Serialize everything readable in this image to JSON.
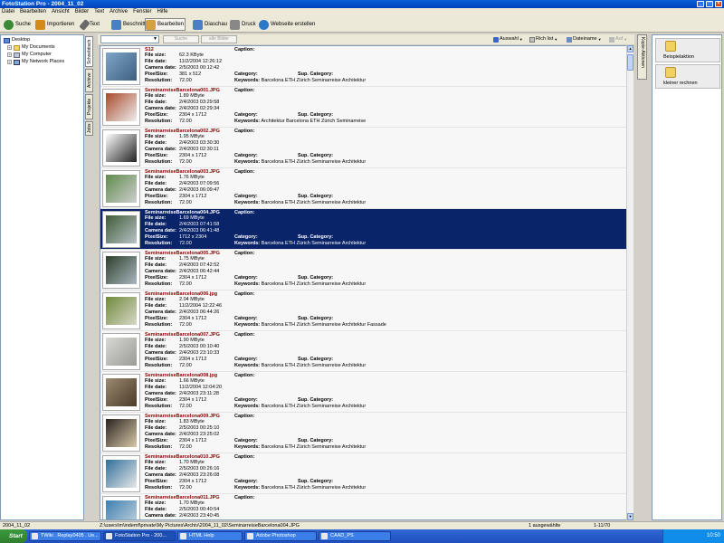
{
  "window": {
    "title": "FotoStation Pro - 2004_11_02"
  },
  "menu": [
    "Datei",
    "Bearbeiten",
    "Ansicht",
    "Bilder",
    "Text",
    "Archive",
    "Fenster",
    "Hilfe"
  ],
  "toolbar": [
    {
      "label": "Suche",
      "color": "#3a8a3a"
    },
    {
      "label": "Importieren",
      "color": "#d48a18"
    },
    {
      "label": "Text",
      "color": "#6a6a6a"
    },
    {
      "label": "Beschnitt",
      "color": "#4a7fc8"
    },
    {
      "label": "Bearbeiten",
      "color": "#d4a040"
    },
    {
      "label": "Diaschau",
      "color": "#4a7fc8"
    },
    {
      "label": "Druck",
      "color": "#888888"
    },
    {
      "label": "Webseite erstellen",
      "color": "#2a78c8"
    }
  ],
  "tree": [
    {
      "label": "Desktop",
      "level": 0,
      "pm": ""
    },
    {
      "label": "My Documents",
      "level": 1,
      "pm": "+"
    },
    {
      "label": "My Computer",
      "level": 1,
      "pm": "+"
    },
    {
      "label": "My Network Places",
      "level": 1,
      "pm": "+"
    }
  ],
  "vtabs": [
    "Schreibtisch",
    "Archive",
    "Projekte",
    "Jobs"
  ],
  "filter": {
    "search_btn": "Suche",
    "all_btn": "alle Bilder",
    "auswahl": "Auswahl",
    "richlist": "Rich list",
    "dateiname": "Dateiname",
    "aufab": "Auf"
  },
  "labels": {
    "file_size": "File size:",
    "file_date": "File date:",
    "camera_date": "Camera date:",
    "pixel_size": "PixelSize:",
    "resolution": "Resolution:",
    "caption": "Caption:",
    "category": "Category:",
    "sup_category": "Sup. Category:",
    "keywords": "Keywords:"
  },
  "files": [
    {
      "name": "S12",
      "size": "62.3 KByte",
      "date": "11/2/2004 12:26:12",
      "camera": "2/5/2003 00:12:42",
      "pixels": "381 x 512",
      "res": "72.00",
      "keywords": "Barcelona ETH Zürich Seminarreise Architektur",
      "selected": false,
      "tone": [
        "#7ea6c8",
        "#3d5f80"
      ]
    },
    {
      "name": "SeminarreiseBarcelona001.JPG",
      "size": "1.89 MByte",
      "date": "2/4/2003 03:29:58",
      "camera": "2/4/2003 02:29:34",
      "pixels": "2304 x 1712",
      "res": "72.00",
      "keywords": "Architektur Barcelona ETH Zürich Seminarreise",
      "selected": false,
      "tone": [
        "#a84a2a",
        "#eeeeee"
      ]
    },
    {
      "name": "SeminarreiseBarcelona002.JPG",
      "size": "1.95 MByte",
      "date": "2/4/2003 03:30:30",
      "camera": "2/4/2003 02:30:11",
      "pixels": "2304 x 1712",
      "res": "72.00",
      "keywords": "Barcelona ETH Zürich Seminarreise Architektur",
      "selected": false,
      "tone": [
        "#ffffff",
        "#222222"
      ]
    },
    {
      "name": "SeminarreiseBarcelona003.JPG",
      "size": "1.76 MByte",
      "date": "2/4/2003 07:09:56",
      "camera": "2/4/2003 06:09:47",
      "pixels": "2304 x 1712",
      "res": "72.00",
      "keywords": "Barcelona ETH Zürich Seminarreise Architektur",
      "selected": false,
      "tone": [
        "#5f8a4c",
        "#cfcfcf"
      ]
    },
    {
      "name": "SeminarreiseBarcelona004.JPG",
      "size": "1.69 MByte",
      "date": "2/4/2003 07:41:58",
      "camera": "2/4/2003 06:41:48",
      "pixels": "1712 x 2304",
      "res": "72.00",
      "keywords": "Barcelona ETH Zürich Seminarreise Architektur",
      "selected": true,
      "tone": [
        "#3f5a35",
        "#b8c4c8"
      ]
    },
    {
      "name": "SeminarreiseBarcelona005.JPG",
      "size": "1.75 MByte",
      "date": "2/4/2003 07:42:52",
      "camera": "2/4/2003 06:42:44",
      "pixels": "2304 x 1712",
      "res": "72.00",
      "keywords": "Barcelona ETH Zürich Seminarreise Architektur",
      "selected": false,
      "tone": [
        "#2e3e2a",
        "#a8b8c0"
      ]
    },
    {
      "name": "SeminarreiseBarcelona006.jpg",
      "size": "2.04 MByte",
      "date": "11/2/2004 12:22:46",
      "camera": "2/4/2003 06:44:26",
      "pixels": "2304 x 1712",
      "res": "72.00",
      "keywords": "Barcelona ETH Zürich Seminarreise Architektur Fassade",
      "selected": false,
      "tone": [
        "#6f8a3c",
        "#d8d8c8"
      ]
    },
    {
      "name": "SeminarreiseBarcelona007.JPG",
      "size": "1.90 MByte",
      "date": "2/5/2003 00:10:40",
      "camera": "2/4/2003 23:10:33",
      "pixels": "2304 x 1712",
      "res": "72.00",
      "keywords": "Barcelona ETH Zürich Seminarreise Architektur",
      "selected": false,
      "tone": [
        "#d8d8d4",
        "#9a9a96"
      ]
    },
    {
      "name": "SeminarreiseBarcelona008.jpg",
      "size": "1.66 MByte",
      "date": "11/2/2004 12:04:20",
      "camera": "2/4/2003 23:11:28",
      "pixels": "2304 x 1712",
      "res": "72.00",
      "keywords": "Barcelona ETH Zürich Seminarreise Architektur",
      "selected": false,
      "tone": [
        "#9a8a70",
        "#4a3a28"
      ]
    },
    {
      "name": "SeminarreiseBarcelona009.JPG",
      "size": "1.83 MByte",
      "date": "2/5/2003 00:25:10",
      "camera": "2/4/2003 23:25:02",
      "pixels": "2304 x 1712",
      "res": "72.00",
      "keywords": "Barcelona ETH Zürich Seminarreise Architektur",
      "selected": false,
      "tone": [
        "#2a2420",
        "#d8c8a8"
      ]
    },
    {
      "name": "SeminarreiseBarcelona010.JPG",
      "size": "1.70 MByte",
      "date": "2/5/2003 00:26:16",
      "camera": "2/4/2003 23:26:08",
      "pixels": "2304 x 1712",
      "res": "72.00",
      "keywords": "Barcelona ETH Zürich Seminarreise Architektur",
      "selected": false,
      "tone": [
        "#2f6f9a",
        "#e8e8e8"
      ]
    },
    {
      "name": "SeminarreiseBarcelona011.JPG",
      "size": "1.70 MByte",
      "date": "2/5/2003 00:40:54",
      "camera": "2/4/2003 23:40:45",
      "pixels": "",
      "res": "",
      "keywords": "",
      "selected": false,
      "tone": [
        "#3f7fb0",
        "#c8d8e0"
      ]
    }
  ],
  "right": {
    "tab": "Kopie-Aktionen",
    "actions": [
      {
        "label": "Beispielaktion"
      },
      {
        "label": "kleiner rechnen"
      }
    ]
  },
  "status": {
    "left": "2004_11_02",
    "path": "Z:\\users\\m\\indemf\\private\\My Pictures\\Archiv\\2004_11_02\\SeminarreiseBarcelona004.JPG",
    "sel": "1 ausgewählte",
    "count": "1-11/70"
  },
  "taskbar": {
    "start": "Start",
    "tasks": [
      {
        "label": "TWiki . Replay0405 . Ue..."
      },
      {
        "label": "FotoStation Pro - 200..."
      },
      {
        "label": "HTML Help"
      },
      {
        "label": "Adobe Photoshop"
      },
      {
        "label": "CAAD_PS"
      }
    ],
    "time": "10:50"
  }
}
